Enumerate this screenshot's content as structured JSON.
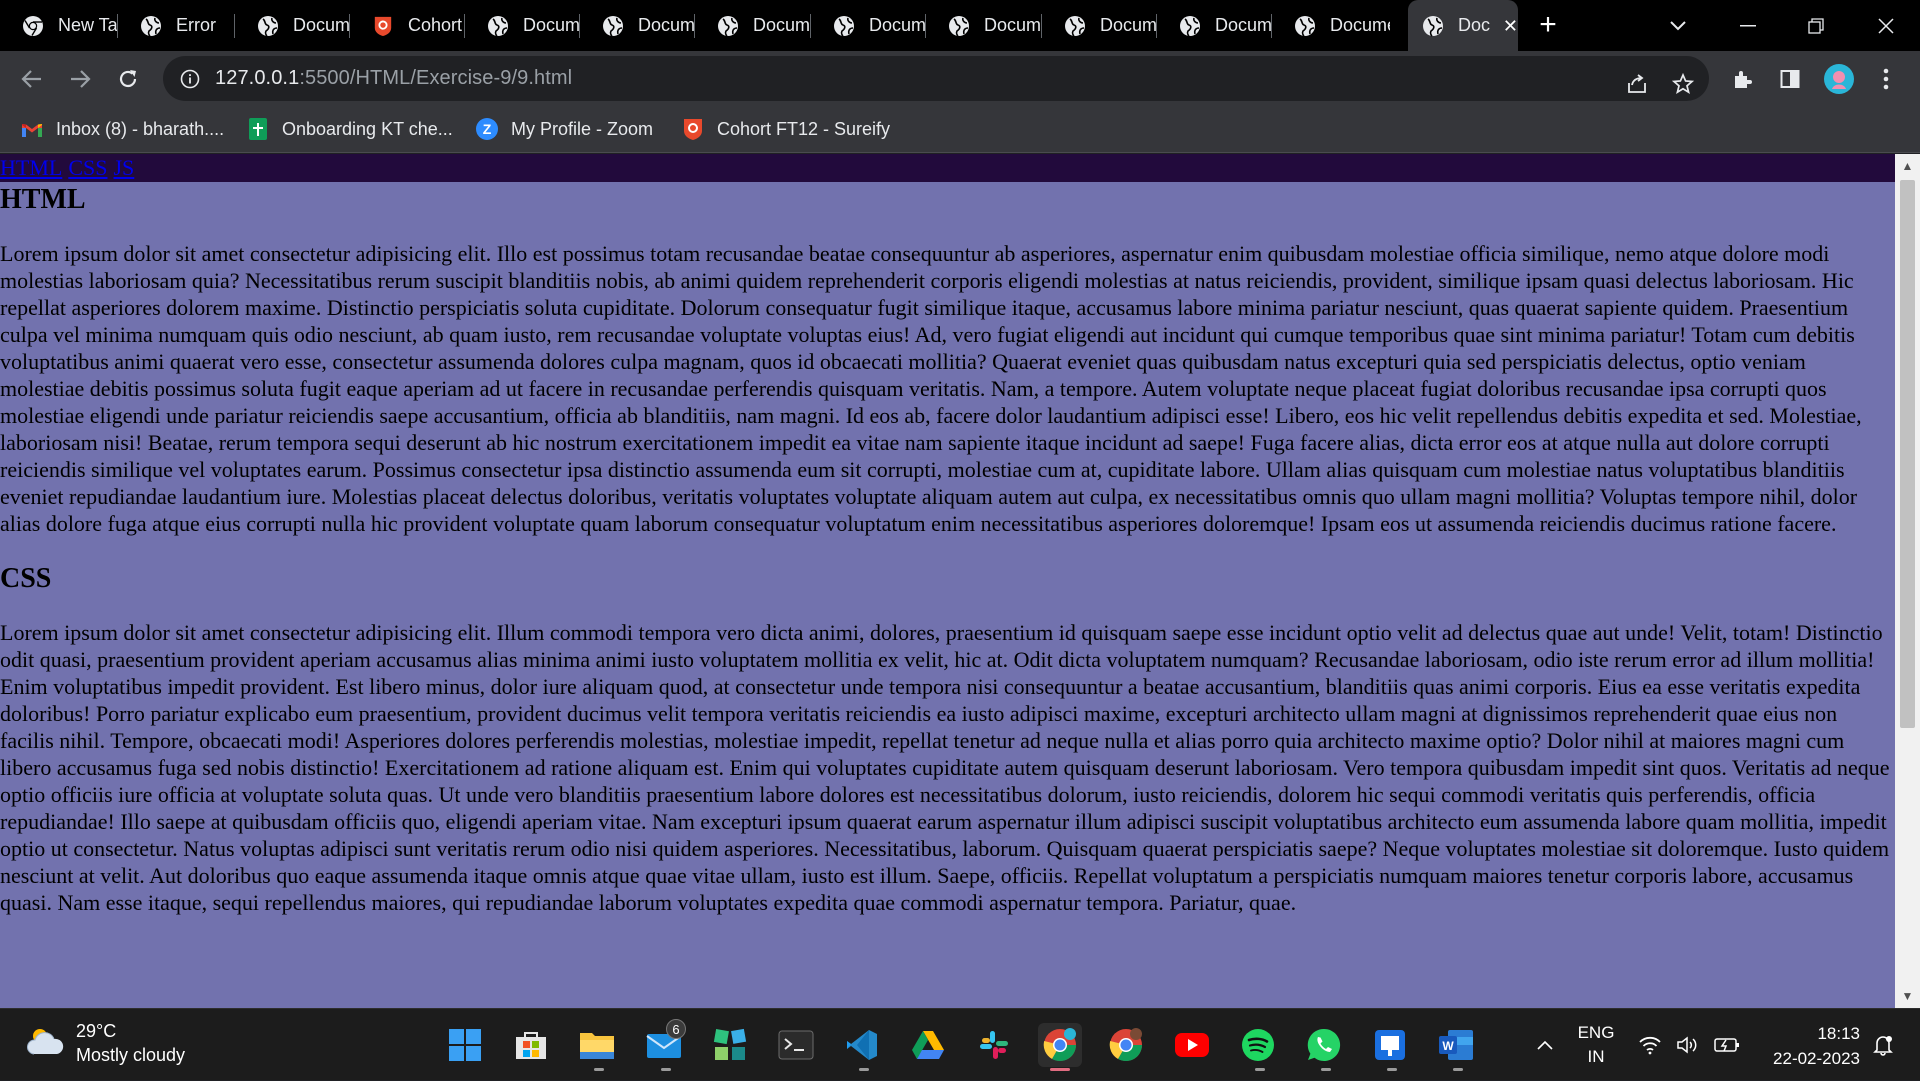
{
  "browser": {
    "tabs": [
      {
        "title": "New Tab",
        "icon": "chrome-icon"
      },
      {
        "title": "Error",
        "icon": "globe-icon"
      },
      {
        "title": "Document",
        "icon": "globe-icon"
      },
      {
        "title": "Cohort",
        "icon": "cohort-icon"
      },
      {
        "title": "Document",
        "icon": "globe-icon"
      },
      {
        "title": "Document",
        "icon": "globe-icon"
      },
      {
        "title": "Document",
        "icon": "globe-icon"
      },
      {
        "title": "Document",
        "icon": "globe-icon"
      },
      {
        "title": "Document",
        "icon": "globe-icon"
      },
      {
        "title": "Document",
        "icon": "globe-icon"
      },
      {
        "title": "Document",
        "icon": "globe-icon"
      },
      {
        "title": "Document",
        "icon": "globe-icon"
      },
      {
        "title": "Document",
        "icon": "globe-icon",
        "active": true
      }
    ],
    "url_host": "127.0.0.1",
    "url_path": ":5500/HTML/Exercise-9/9.html",
    "bookmarks": [
      {
        "label": "Inbox (8) - bharath....",
        "icon": "gmail-icon"
      },
      {
        "label": "Onboarding KT che...",
        "icon": "sheets-icon"
      },
      {
        "label": "My Profile - Zoom",
        "icon": "zoom-icon"
      },
      {
        "label": "Cohort FT12 - Sureify",
        "icon": "cohort-icon"
      }
    ],
    "colors": {
      "tabstrip": "#000000",
      "toolbar": "#35363a",
      "page_bg": "#7272ae",
      "navbar_bg": "#220a3c"
    }
  },
  "page": {
    "nav": [
      "HTML",
      "CSS",
      "JS"
    ],
    "sections": [
      {
        "heading": "HTML",
        "body": "Lorem ipsum dolor sit amet consectetur adipisicing elit. Illo est possimus totam recusandae beatae consequuntur ab asperiores, aspernatur enim quibusdam molestiae officia similique, nemo atque dolore modi molestias laboriosam quia? Necessitatibus rerum suscipit blanditiis nobis, ab animi quidem reprehenderit corporis eligendi molestias at natus reiciendis, provident, similique ipsam quasi delectus laboriosam. Hic repellat asperiores dolorem maxime. Distinctio perspiciatis soluta cupiditate. Dolorum consequatur fugit similique itaque, accusamus labore minima pariatur nesciunt, quas quaerat sapiente quidem. Praesentium culpa vel minima numquam quis odio nesciunt, ab quam iusto, rem recusandae voluptate voluptas eius! Ad, vero fugiat eligendi aut incidunt qui cumque temporibus quae sint minima pariatur! Totam cum debitis voluptatibus animi quaerat vero esse, consectetur assumenda dolores culpa magnam, quos id obcaecati mollitia? Quaerat eveniet quas quibusdam natus excepturi quia sed perspiciatis delectus, optio veniam molestiae debitis possimus soluta fugit eaque aperiam ad ut facere in recusandae perferendis quisquam veritatis. Nam, a tempore. Autem voluptate neque placeat fugiat doloribus recusandae ipsa corrupti quos molestiae eligendi unde pariatur reiciendis saepe accusantium, officia ab blanditiis, nam magni. Id eos ab, facere dolor laudantium adipisci esse! Libero, eos hic velit repellendus debitis expedita et sed. Molestiae, laboriosam nisi! Beatae, rerum tempora sequi deserunt ab hic nostrum exercitationem impedit ea vitae nam sapiente itaque incidunt ad saepe! Fuga facere alias, dicta error eos at atque nulla aut dolore corrupti reiciendis similique vel voluptates earum. Possimus consectetur ipsa distinctio assumenda eum sit corrupti, molestiae cum at, cupiditate labore. Ullam alias quisquam cum molestiae natus voluptatibus blanditiis eveniet repudiandae laudantium iure. Molestias placeat delectus doloribus, veritatis voluptates voluptate aliquam autem aut culpa, ex necessitatibus omnis quo ullam magni mollitia? Voluptas tempore nihil, dolor alias dolore fuga atque eius corrupti nulla hic provident voluptate quam laborum consequatur voluptatum enim necessitatibus asperiores doloremque! Ipsam eos ut assumenda reiciendis ducimus ratione facere."
      },
      {
        "heading": "CSS",
        "body": "Lorem ipsum dolor sit amet consectetur adipisicing elit. Illum commodi tempora vero dicta animi, dolores, praesentium id quisquam saepe esse incidunt optio velit ad delectus quae aut unde! Velit, totam! Distinctio odit quasi, praesentium provident aperiam accusamus alias minima animi iusto voluptatem mollitia ex velit, hic at. Odit dicta voluptatem numquam? Recusandae laboriosam, odio iste rerum error ad illum mollitia! Enim voluptatibus impedit provident. Est libero minus, dolor iure aliquam quod, at consectetur unde tempora nisi consequuntur a beatae accusantium, blanditiis quas animi corporis. Eius ea esse veritatis expedita doloribus! Porro pariatur explicabo eum praesentium, provident ducimus velit tempora veritatis reiciendis ea iusto adipisci maxime, excepturi architecto ullam magni at dignissimos reprehenderit quae eius non facilis nihil. Tempore, obcaecati modi! Asperiores dolores perferendis molestias, molestiae impedit, repellat tenetur ad neque nulla et alias porro quia architecto maxime optio? Dolor nihil at maiores magni cum libero accusamus fuga sed nobis distinctio! Exercitationem ad ratione aliquam est. Enim qui voluptates cupiditate autem quisquam deserunt laboriosam. Vero tempora quibusdam impedit sint quos. Veritatis ad neque optio officiis iure officia at voluptate soluta quas. Ut unde vero blanditiis praesentium labore dolores est necessitatibus dolorum, iusto reiciendis, dolorem hic sequi commodi veritatis quis perferendis, officia repudiandae! Illo saepe at quibusdam officiis quo, eligendi aperiam vitae. Nam excepturi ipsum quaerat earum aspernatur illum adipisci suscipit voluptatibus architecto eum assumenda labore quam mollitia, impedit optio ut consectetur. Natus voluptas adipisci sunt veritatis rerum odio nisi quidem asperiores. Necessitatibus, laborum. Quisquam quaerat perspiciatis saepe? Neque voluptates molestiae sit doloremque. Iusto quidem nesciunt at velit. Aut doloribus quo eaque assumenda itaque omnis atque quae vitae ullam, iusto est illum. Saepe, officiis. Repellat voluptatum a perspiciatis numquam maiores tenetur corporis labore, accusamus quasi. Nam esse itaque, sequi repellendus maiores, qui repudiandae laborum voluptates expedita quae commodi aspernatur tempora. Pariatur, quae."
      }
    ]
  },
  "taskbar": {
    "weather_temp": "29°C",
    "weather_desc": "Mostly cloudy",
    "mail_badge": "6",
    "apps": [
      "start-icon",
      "store-icon",
      "file-explorer-icon",
      "mail-icon",
      "widgets-icon",
      "terminal-icon",
      "vscode-icon",
      "google-drive-icon",
      "slack-icon",
      "chrome-icon",
      "chrome-profile-icon",
      "youtube-icon",
      "spotify-icon",
      "whatsapp-icon",
      "todo-icon",
      "word-icon"
    ],
    "lang_1": "ENG",
    "lang_2": "IN",
    "time": "18:13",
    "date": "22-02-2023"
  }
}
